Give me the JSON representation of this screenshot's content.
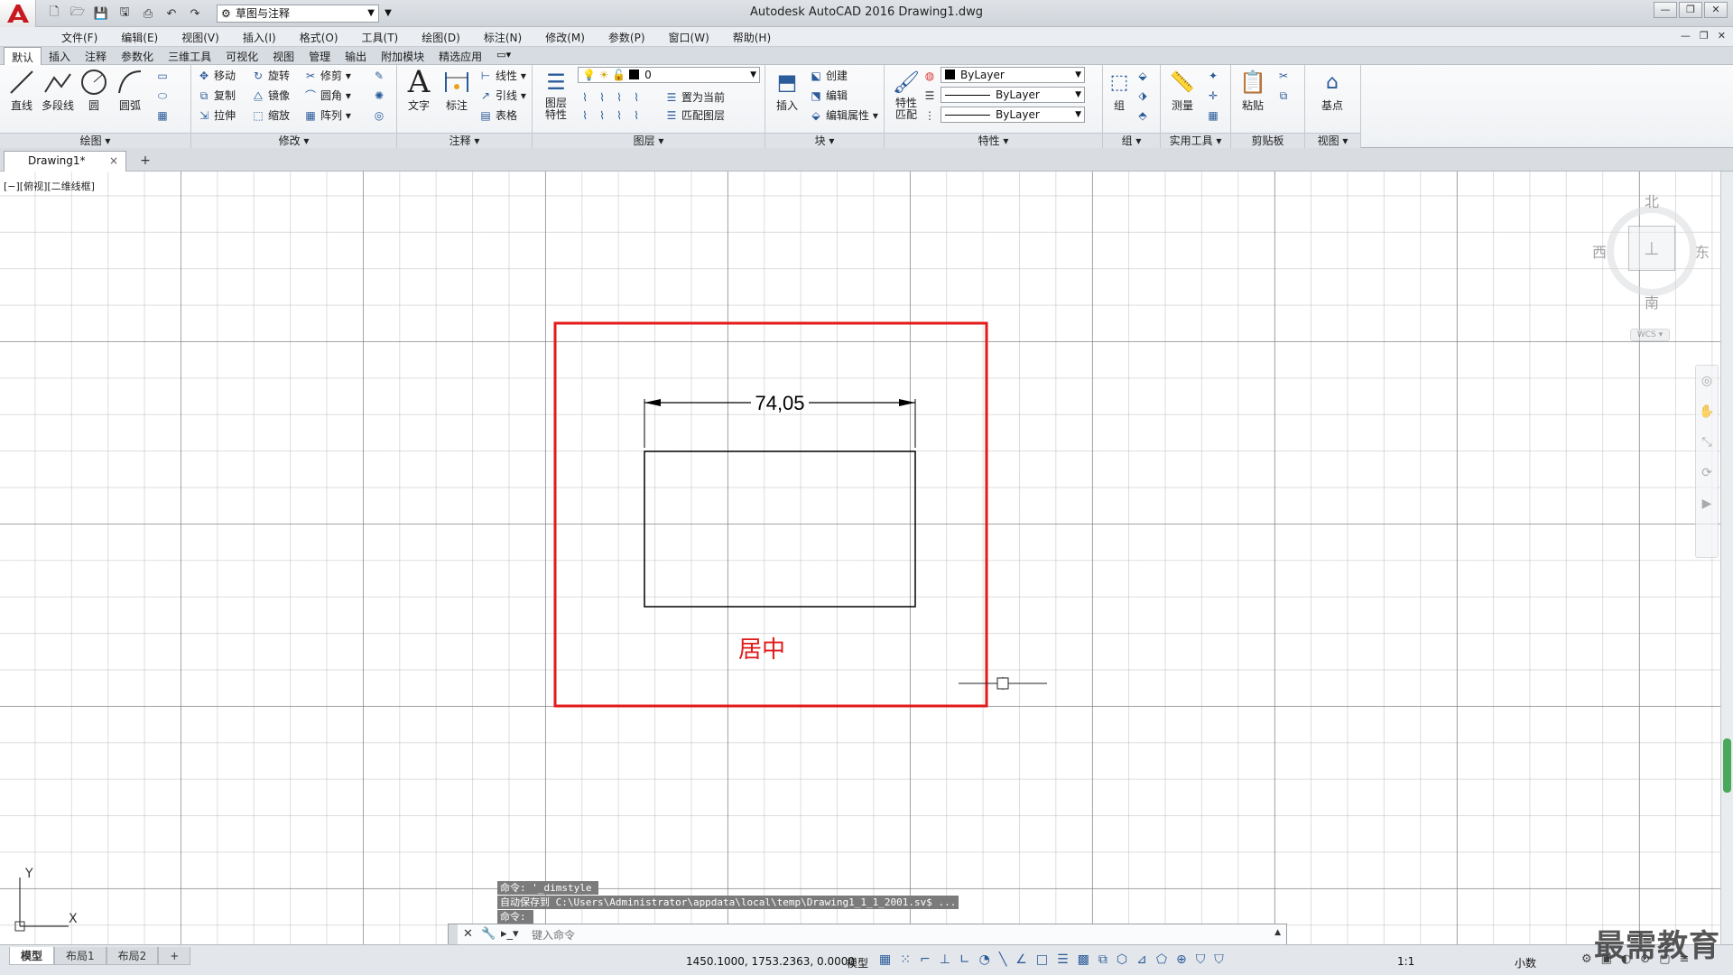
{
  "window": {
    "title": "Autodesk AutoCAD 2016    Drawing1.dwg",
    "workspace": "草图与注释"
  },
  "menu": [
    "文件(F)",
    "编辑(E)",
    "视图(V)",
    "插入(I)",
    "格式(O)",
    "工具(T)",
    "绘图(D)",
    "标注(N)",
    "修改(M)",
    "参数(P)",
    "窗口(W)",
    "帮助(H)"
  ],
  "ribbon_tabs": [
    "默认",
    "插入",
    "注释",
    "参数化",
    "三维工具",
    "可视化",
    "视图",
    "管理",
    "输出",
    "附加模块",
    "精选应用"
  ],
  "ribbon": {
    "draw": {
      "title": "绘图",
      "line": "直线",
      "polyline": "多段线",
      "circle": "圆",
      "arc": "圆弧"
    },
    "modify": {
      "title": "修改",
      "move": "移动",
      "rotate": "旋转",
      "trim": "修剪",
      "copy": "复制",
      "mirror": "镜像",
      "fillet": "圆角",
      "stretch": "拉伸",
      "scale": "缩放",
      "array": "阵列"
    },
    "annotation": {
      "title": "注释",
      "text": "文字",
      "dimension": "标注",
      "linear": "线性",
      "leader": "引线",
      "table": "表格"
    },
    "layers": {
      "title": "图层",
      "properties": "图层\n特性",
      "layer_value": "0",
      "set_current": "置为当前",
      "match_layer": "匹配图层"
    },
    "block": {
      "title": "块",
      "insert": "插入",
      "create": "创建",
      "edit": "编辑",
      "edit_attr": "编辑属性"
    },
    "properties": {
      "title": "特性",
      "match": "特性\n匹配",
      "color": "ByLayer",
      "linetype": "ByLayer",
      "lineweight": "ByLayer"
    },
    "groups": {
      "title": "组",
      "group": "组"
    },
    "utilities": {
      "title": "实用工具",
      "measure": "测量"
    },
    "clipboard": {
      "title": "剪贴板",
      "paste": "粘贴"
    },
    "view": {
      "title": "视图",
      "basepoint": "基点"
    }
  },
  "file_tab": "Drawing1*",
  "viewport_label": "[−][俯视][二维线框]",
  "drawing": {
    "dimension_text": "74,05",
    "annotation_label": "居中"
  },
  "viewcube": {
    "north": "北",
    "south": "南",
    "east": "东",
    "west": "西",
    "wcs": "WCS"
  },
  "command": {
    "history": [
      "命令: '_dimstyle",
      "自动保存到 C:\\Users\\Administrator\\appdata\\local\\temp\\Drawing1_1_1_2001.sv$ ...",
      "命令:"
    ],
    "placeholder": "键入命令"
  },
  "ucs": {
    "x": "X",
    "y": "Y"
  },
  "status": {
    "layout_tabs": [
      "模型",
      "布局1",
      "布局2"
    ],
    "coords": "1450.1000, 1753.2363, 0.0000",
    "model": "模型",
    "scale": "1:1",
    "units": "小数"
  },
  "watermark": "最需教育",
  "colors": {
    "annotation_red": "#e21a1a",
    "accent": "#2a5b9a"
  }
}
